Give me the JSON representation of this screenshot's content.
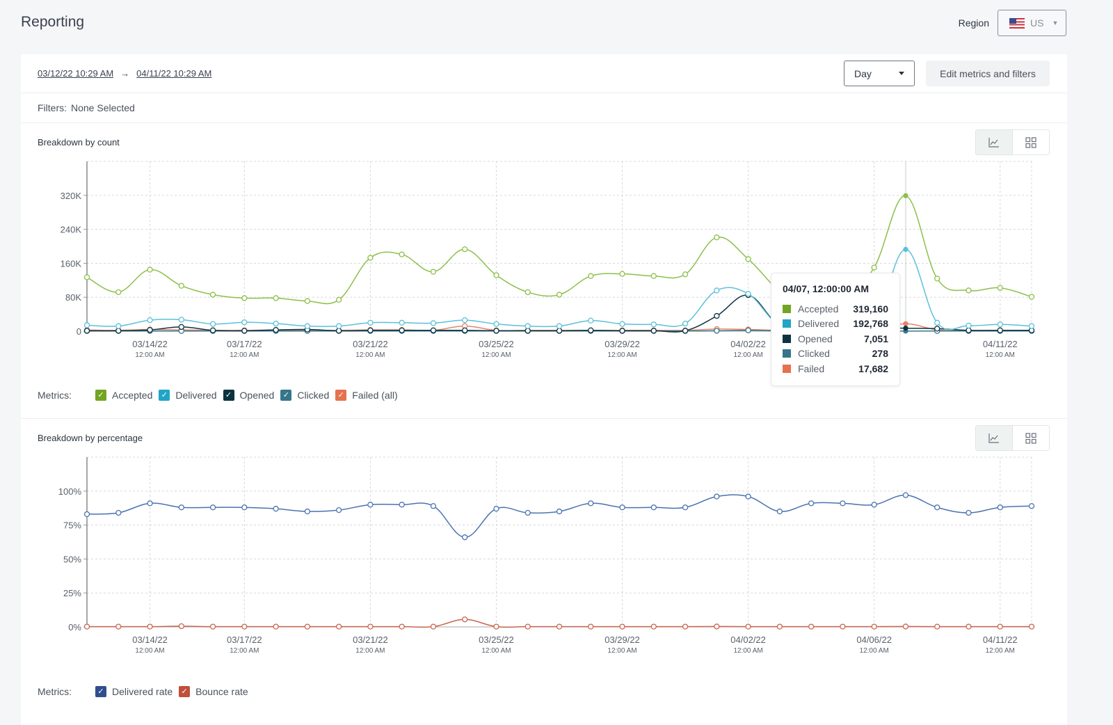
{
  "header": {
    "title": "Reporting",
    "region_label": "Region",
    "region_value": "US",
    "region_flag_icon": "us-flag-icon"
  },
  "toolbar": {
    "date_from": "03/12/22 10:29 AM",
    "arrow": "→",
    "date_to": "04/11/22 10:29 AM",
    "granularity": "Day",
    "edit_button": "Edit metrics and filters"
  },
  "filters": {
    "label": "Filters:",
    "value": "None Selected"
  },
  "count_section": {
    "title": "Breakdown by count",
    "metrics_label": "Metrics:",
    "metrics": [
      {
        "label": "Accepted",
        "color": "#72a521",
        "checked": true
      },
      {
        "label": "Delivered",
        "color": "#21a5c6",
        "checked": true
      },
      {
        "label": "Opened",
        "color": "#0d3340",
        "checked": true
      },
      {
        "label": "Clicked",
        "color": "#36768a",
        "checked": true
      },
      {
        "label": "Failed (all)",
        "color": "#e5714f",
        "checked": true
      }
    ],
    "tooltip": {
      "title": "04/07, 12:00:00 AM",
      "rows": [
        {
          "label": "Accepted",
          "value": "319,160",
          "color": "#72a521"
        },
        {
          "label": "Delivered",
          "value": "192,768",
          "color": "#21a5c6"
        },
        {
          "label": "Opened",
          "value": "7,051",
          "color": "#0d3340"
        },
        {
          "label": "Clicked",
          "value": "278",
          "color": "#36768a"
        },
        {
          "label": "Failed",
          "value": "17,682",
          "color": "#e5714f"
        }
      ]
    }
  },
  "percent_section": {
    "title": "Breakdown by percentage",
    "metrics_label": "Metrics:",
    "metrics": [
      {
        "label": "Delivered rate",
        "color": "#2f4f8f",
        "checked": true
      },
      {
        "label": "Bounce rate",
        "color": "#c1503a",
        "checked": true
      }
    ]
  },
  "chart_data": [
    {
      "type": "line",
      "title": "Breakdown by count",
      "x": [
        "03/12",
        "03/13",
        "03/14",
        "03/15",
        "03/16",
        "03/17",
        "03/18",
        "03/19",
        "03/20",
        "03/21",
        "03/22",
        "03/23",
        "03/24",
        "03/25",
        "03/26",
        "03/27",
        "03/28",
        "03/29",
        "03/30",
        "03/31",
        "04/01",
        "04/02",
        "04/03",
        "04/04",
        "04/05",
        "04/06",
        "04/07",
        "04/08",
        "04/09",
        "04/10",
        "04/11"
      ],
      "x_tick_labels": [
        {
          "index": 2,
          "date": "03/14/22",
          "time": "12:00 AM"
        },
        {
          "index": 5,
          "date": "03/17/22",
          "time": "12:00 AM"
        },
        {
          "index": 9,
          "date": "03/21/22",
          "time": "12:00 AM"
        },
        {
          "index": 13,
          "date": "03/25/22",
          "time": "12:00 AM"
        },
        {
          "index": 17,
          "date": "03/29/22",
          "time": "12:00 AM"
        },
        {
          "index": 21,
          "date": "04/02/22",
          "time": "12:00 AM"
        },
        {
          "index": 25,
          "date": "04/06/22",
          "time": "12:00 AM"
        },
        {
          "index": 29,
          "date": "04/11/22",
          "time": "12:00 AM"
        }
      ],
      "y_ticks": [
        0,
        80000,
        160000,
        240000,
        320000
      ],
      "y_tick_labels": [
        "0",
        "80K",
        "160K",
        "240K",
        "320K"
      ],
      "ylim": [
        0,
        400000
      ],
      "grid": true,
      "highlight_index": 26,
      "series": [
        {
          "name": "Accepted",
          "color": "#8cbf4a",
          "values": [
            127000,
            92000,
            145000,
            107000,
            86000,
            78000,
            78000,
            71000,
            74000,
            173000,
            181000,
            140000,
            193000,
            132000,
            92000,
            86000,
            130000,
            135000,
            130000,
            134000,
            221000,
            170000,
            95000,
            62000,
            75000,
            150000,
            319160,
            124000,
            96000,
            102000,
            81000
          ]
        },
        {
          "name": "Delivered",
          "color": "#5bc0d8",
          "values": [
            14000,
            12000,
            26000,
            27000,
            17000,
            21000,
            18000,
            12000,
            12000,
            20000,
            20000,
            19000,
            26000,
            17000,
            12000,
            12000,
            25000,
            17000,
            16000,
            18000,
            96000,
            88000,
            14000,
            24000,
            22000,
            20000,
            192768,
            20000,
            13000,
            16000,
            12000
          ]
        },
        {
          "name": "Opened",
          "color": "#0d3340",
          "values": [
            1000,
            1000,
            3000,
            10000,
            2000,
            1000,
            3000,
            4000,
            1000,
            2000,
            2000,
            2000,
            2000,
            1000,
            1000,
            1000,
            2000,
            1000,
            1000,
            1000,
            36000,
            85000,
            15000,
            30000,
            13000,
            9000,
            7051,
            6000,
            2000,
            2000,
            2000
          ]
        },
        {
          "name": "Clicked",
          "color": "#36768a",
          "values": [
            500,
            500,
            500,
            500,
            500,
            500,
            500,
            500,
            500,
            500,
            500,
            500,
            500,
            500,
            500,
            500,
            500,
            500,
            500,
            500,
            1000,
            2000,
            500,
            500,
            500,
            500,
            278,
            500,
            500,
            500,
            500
          ]
        },
        {
          "name": "Failed",
          "color": "#e8836a",
          "values": [
            3000,
            2000,
            4000,
            3000,
            2000,
            2000,
            3000,
            2000,
            2000,
            3000,
            3000,
            2000,
            12000,
            2000,
            2000,
            2000,
            2000,
            2000,
            2000,
            2000,
            5000,
            4000,
            2000,
            2000,
            2000,
            2000,
            17682,
            3000,
            2000,
            2000,
            2000
          ]
        }
      ]
    },
    {
      "type": "line",
      "title": "Breakdown by percentage",
      "x": [
        "03/12",
        "03/13",
        "03/14",
        "03/15",
        "03/16",
        "03/17",
        "03/18",
        "03/19",
        "03/20",
        "03/21",
        "03/22",
        "03/23",
        "03/24",
        "03/25",
        "03/26",
        "03/27",
        "03/28",
        "03/29",
        "03/30",
        "03/31",
        "04/01",
        "04/02",
        "04/03",
        "04/04",
        "04/05",
        "04/06",
        "04/07",
        "04/08",
        "04/09",
        "04/10",
        "04/11"
      ],
      "x_tick_labels": [
        {
          "index": 2,
          "date": "03/14/22",
          "time": "12:00 AM"
        },
        {
          "index": 5,
          "date": "03/17/22",
          "time": "12:00 AM"
        },
        {
          "index": 9,
          "date": "03/21/22",
          "time": "12:00 AM"
        },
        {
          "index": 13,
          "date": "03/25/22",
          "time": "12:00 AM"
        },
        {
          "index": 17,
          "date": "03/29/22",
          "time": "12:00 AM"
        },
        {
          "index": 21,
          "date": "04/02/22",
          "time": "12:00 AM"
        },
        {
          "index": 25,
          "date": "04/06/22",
          "time": "12:00 AM"
        },
        {
          "index": 29,
          "date": "04/11/22",
          "time": "12:00 AM"
        }
      ],
      "y_ticks": [
        0,
        25,
        50,
        75,
        100
      ],
      "y_tick_labels": [
        "0%",
        "25%",
        "50%",
        "75%",
        "100%"
      ],
      "ylim": [
        0,
        125
      ],
      "grid": true,
      "series": [
        {
          "name": "Delivered rate",
          "color": "#4a72b0",
          "values": [
            83,
            84,
            91,
            88,
            88,
            88,
            87,
            85,
            86,
            90,
            90,
            89,
            66,
            87,
            84,
            85,
            91,
            88,
            88,
            88,
            96,
            96,
            85,
            91,
            91,
            90,
            97,
            88,
            84,
            88,
            89
          ]
        },
        {
          "name": "Bounce rate",
          "color": "#c9654e",
          "values": [
            0.2,
            0.2,
            0.2,
            0.5,
            0.2,
            0.2,
            0.2,
            0.2,
            0.2,
            0.2,
            0.2,
            0.2,
            5.5,
            0.2,
            0.2,
            0.2,
            0.2,
            0.2,
            0.2,
            0.2,
            0.3,
            0.2,
            0.2,
            0.2,
            0.2,
            0.2,
            0.3,
            0.2,
            0.2,
            0.2,
            0.2
          ]
        }
      ]
    }
  ]
}
